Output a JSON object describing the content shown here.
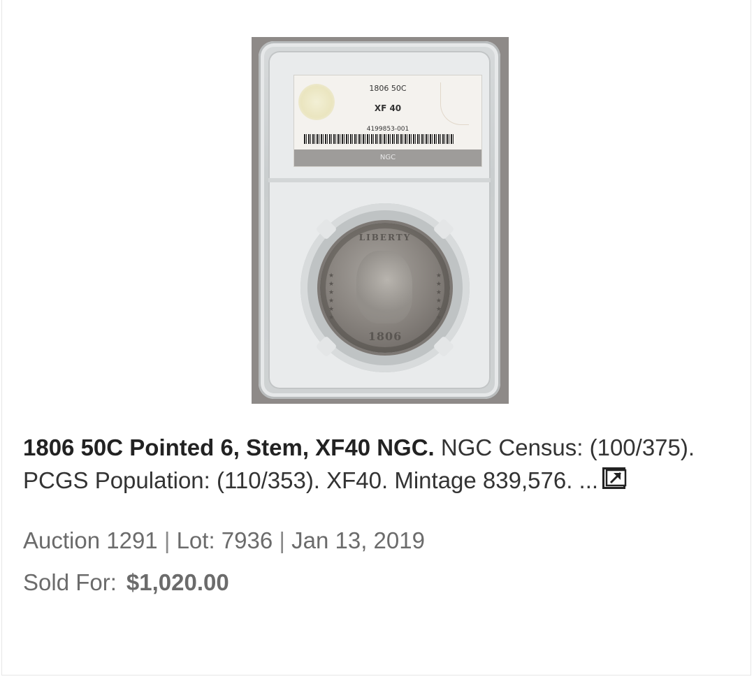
{
  "lot": {
    "slab_label": {
      "line1": "1806 50C",
      "grade": "XF 40",
      "cert_number": "4199853-001",
      "grader": "NGC"
    },
    "coin": {
      "legend": "LIBERTY",
      "date": "1806"
    },
    "title": "1806 50C Pointed 6, Stem, XF40 NGC.",
    "description": " NGC Census: (100/375). PCGS Population: (110/353). XF40. Mintage 839,576. ...",
    "auction": "Auction 1291",
    "separator": " | ",
    "lot_label": "Lot: 7936",
    "date": "Jan 13, 2019",
    "sold_label": "Sold For:",
    "sold_price": "$1,020.00",
    "icons": {
      "popout": "external-link-icon"
    }
  }
}
